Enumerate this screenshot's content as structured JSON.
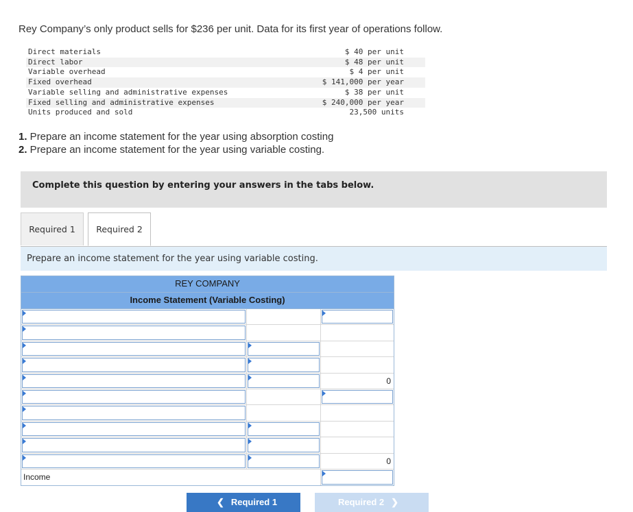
{
  "intro": "Rey Company’s only product sells for $236 per unit. Data for its first year of operations follow.",
  "cost_data": [
    {
      "label": "Direct materials",
      "value": "$ 40 per unit"
    },
    {
      "label": "Direct labor",
      "value": "$ 48 per unit"
    },
    {
      "label": "Variable overhead",
      "value": "$ 4 per unit"
    },
    {
      "label": "Fixed overhead",
      "value": "$ 141,000 per year"
    },
    {
      "label": "Variable selling and administrative expenses",
      "value": "$ 38 per unit"
    },
    {
      "label": "Fixed selling and administrative expenses",
      "value": "$ 240,000 per year"
    },
    {
      "label": "Units produced and sold",
      "value": "23,500 units"
    }
  ],
  "questions": [
    {
      "num": "1.",
      "text": " Prepare an income statement for the year using absorption costing"
    },
    {
      "num": "2.",
      "text": " Prepare an income statement for the year using variable costing."
    }
  ],
  "banner": "Complete this question by entering your answers in the tabs below.",
  "tabs": [
    "Required 1",
    "Required 2"
  ],
  "instruction": "Prepare an income statement for the year using variable costing.",
  "statement": {
    "company": "REY COMPANY",
    "title": "Income Statement (Variable Costing)",
    "subtotal1": "0",
    "subtotal2": "0",
    "income_label": "Income"
  },
  "nav": {
    "prev": "Required 1",
    "next": "Required 2"
  }
}
